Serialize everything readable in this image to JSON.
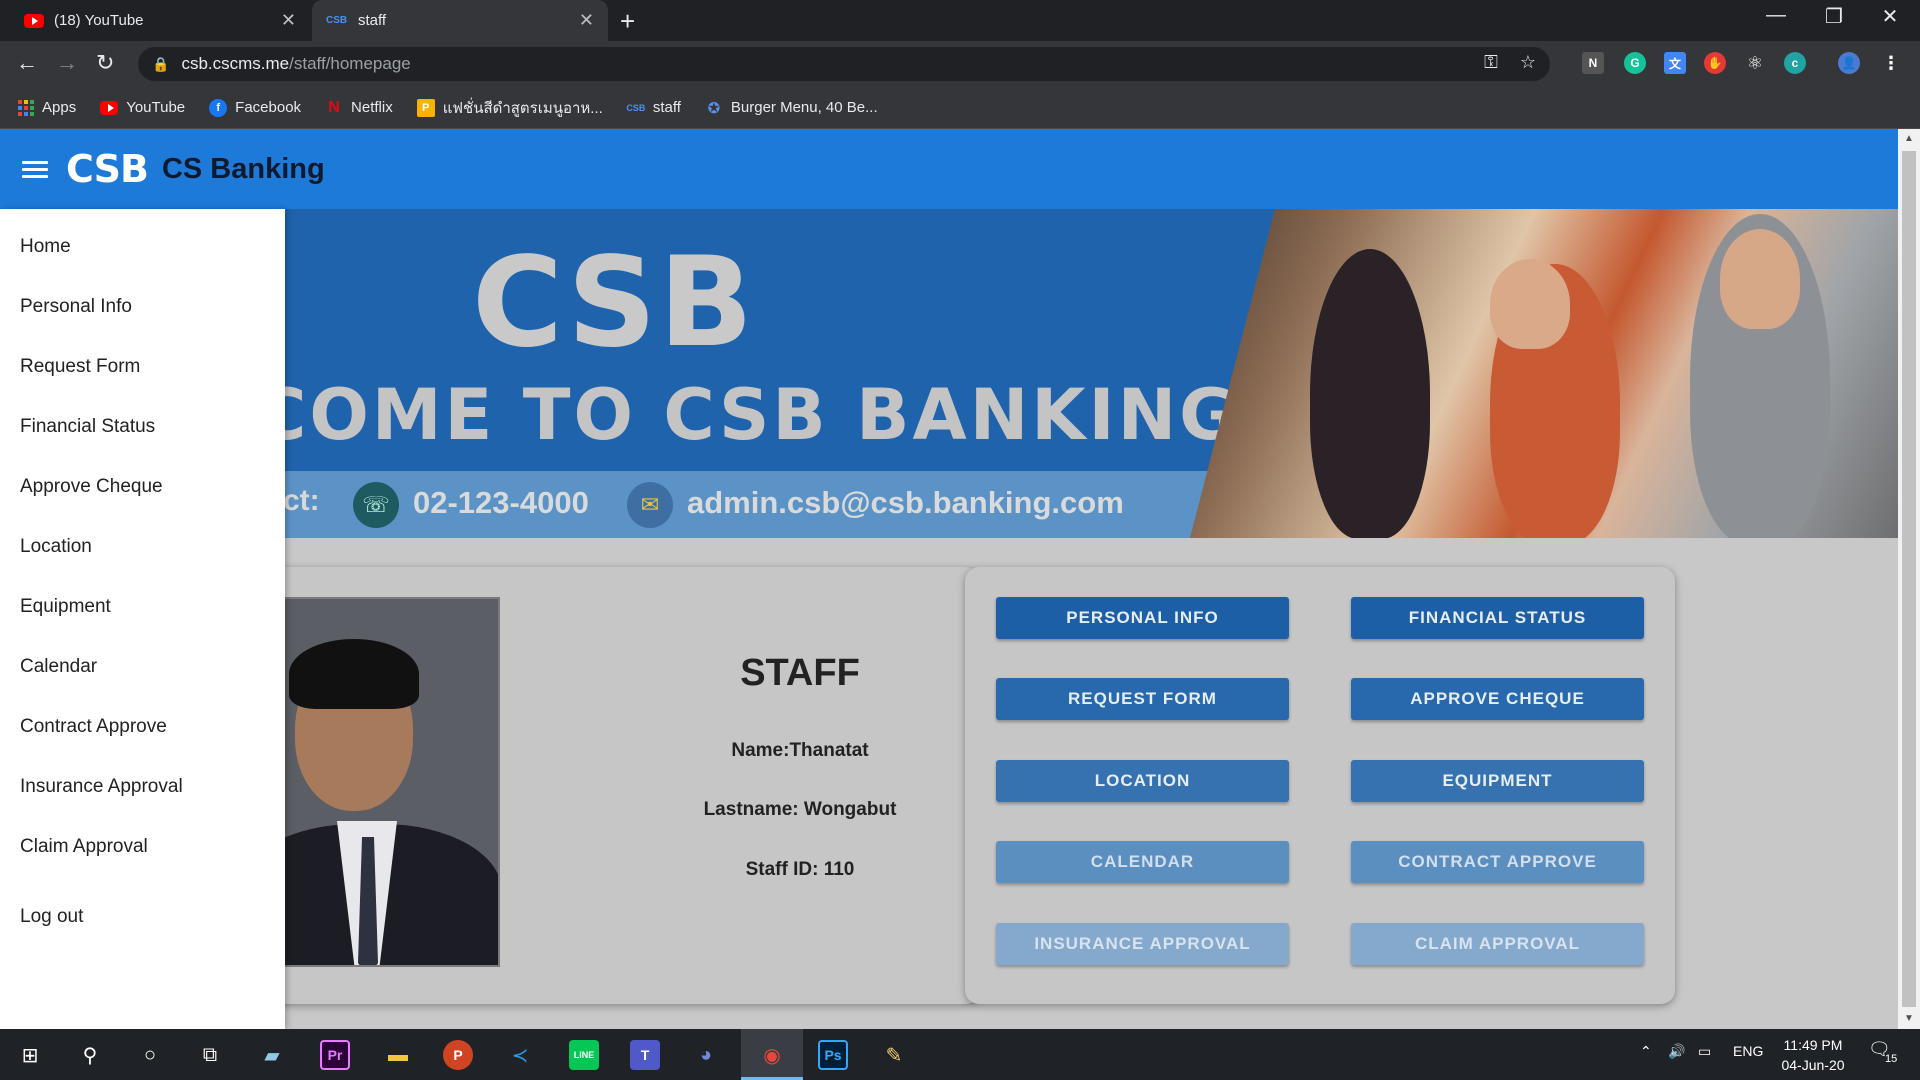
{
  "browser": {
    "tabs": [
      {
        "title": "(18) YouTube",
        "active": false
      },
      {
        "title": "staff",
        "favicon_text": "CSB",
        "active": true
      }
    ],
    "new_tab": "+",
    "window_controls": {
      "minimize": "—",
      "restore": "❐",
      "close": "✕"
    },
    "url_host": "csb.cscms.me",
    "url_path": "/staff/homepage",
    "bookmarks": [
      {
        "label": "Apps",
        "icon": "apps-grid-icon"
      },
      {
        "label": "YouTube",
        "icon": "youtube-icon"
      },
      {
        "label": "Facebook",
        "icon": "facebook-icon"
      },
      {
        "label": "Netflix",
        "icon": "netflix-icon"
      },
      {
        "label": "แฟชั่นสีดำสูตรเมนูอาห...",
        "icon": "bookmark-p-icon"
      },
      {
        "label": "staff",
        "icon": "csb-icon"
      },
      {
        "label": "Burger Menu, 40 Be...",
        "icon": "burger-icon"
      }
    ]
  },
  "app": {
    "logo": "CSB",
    "title": "CS Banking",
    "accent": "#1e7ad9"
  },
  "drawer": {
    "items": [
      "Home",
      "Personal Info",
      "Request Form",
      "Financial Status",
      "Approve Cheque",
      "Location",
      "Equipment",
      "Calendar",
      "Contract Approve",
      "Insurance Approval",
      "Claim Approval"
    ],
    "logout": "Log out"
  },
  "banner": {
    "brand": "CSB",
    "welcome": "COME TO CSB BANKING",
    "contact_label": "ct:",
    "phone": "02-123-4000",
    "email": "admin.csb@csb.banking.com"
  },
  "staff": {
    "heading": "STAFF",
    "name": "Name:Thanatat",
    "lastname": "Lastname: Wongabut",
    "staff_id": "Staff ID: 110"
  },
  "buttons": [
    "PERSONAL INFO",
    "FINANCIAL STATUS",
    "REQUEST FORM",
    "APPROVE CHEQUE",
    "LOCATION",
    "EQUIPMENT",
    "CALENDAR",
    "CONTRACT APPROVE",
    "INSURANCE APPROVAL",
    "CLAIM APPROVAL"
  ],
  "taskbar": {
    "language": "ENG",
    "time": "11:49 PM",
    "date": "04-Jun-20",
    "notifications": "15",
    "apps": [
      "Pr",
      "P",
      "Ps"
    ]
  }
}
